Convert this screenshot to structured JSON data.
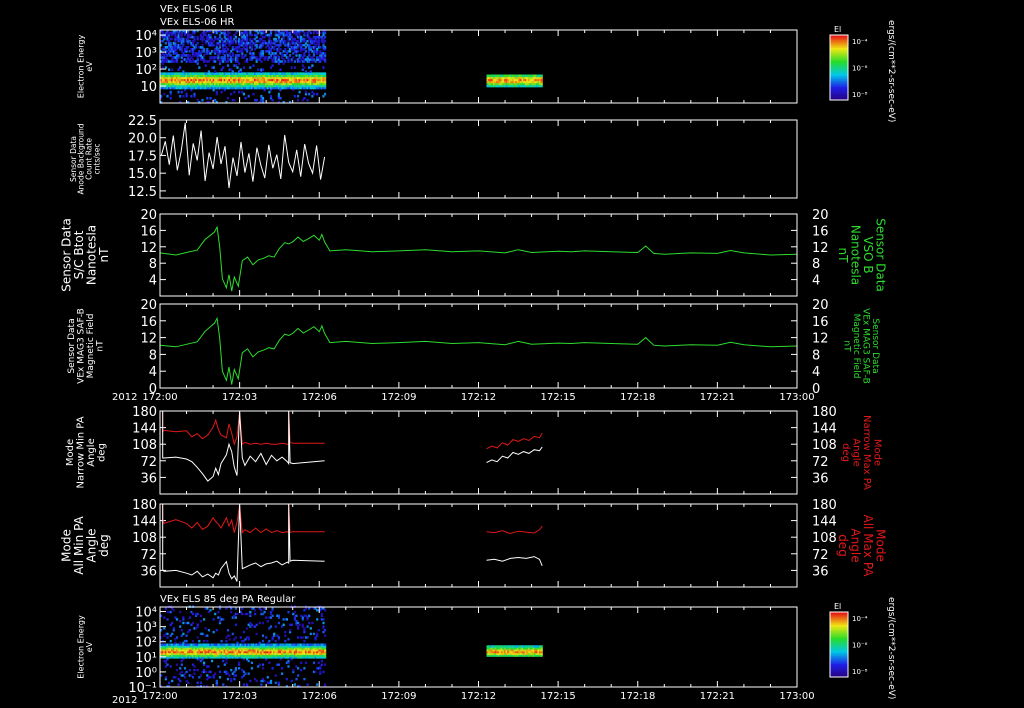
{
  "figure": {
    "top_titles": [
      "VEx ELS-06 LR",
      "VEx ELS-06 HR"
    ],
    "bottom_panel_title": "VEx ELS 85 deg PA Regular",
    "year_label": "2012",
    "colors": {
      "background": "#000000",
      "axis": "#ffffff",
      "series_white": "#ffffff",
      "series_green": "#2ddc2d",
      "series_red": "#e01818"
    }
  },
  "chart_data": [
    {
      "id": "spec-top",
      "type": "heatmap",
      "ylabel": [
        "Electron Energy",
        "eV"
      ],
      "yscale": "log",
      "ylim": [
        1,
        20000
      ],
      "yticks": [
        {
          "v": 10,
          "label": "10"
        },
        {
          "v": 100,
          "label": "10²"
        },
        {
          "v": 1000,
          "label": "10³"
        },
        {
          "v": 10000,
          "label": "10⁴"
        }
      ],
      "x_data_intervals_min": [
        [
          0,
          6.2
        ],
        [
          12.3,
          14.4
        ]
      ],
      "colorbar": {
        "title": "El",
        "unit": "ergs/(cm**2-sr-sec-eV)",
        "ticks": [
          "10⁻⁴",
          "10⁻⁶",
          "10⁻⁸"
        ]
      }
    },
    {
      "id": "anode-bg",
      "type": "line",
      "ylabel": [
        "Sensor Data",
        "Anode Background",
        "Count Rate",
        "cnts/sec"
      ],
      "ylim": [
        11.5,
        22.5
      ],
      "yticks": [
        12.5,
        15.0,
        17.5,
        20.0,
        22.5
      ],
      "ytick_labels": [
        "12.5",
        "15.0",
        "17.5",
        "20.0",
        "22.5"
      ],
      "series": [
        {
          "color": "white",
          "x": [
            0.05,
            0.2,
            0.35,
            0.5,
            0.65,
            0.8,
            0.95,
            1.1,
            1.25,
            1.4,
            1.55,
            1.7,
            1.85,
            2.0,
            2.15,
            2.3,
            2.45,
            2.6,
            2.75,
            2.9,
            3.05,
            3.2,
            3.35,
            3.5,
            3.65,
            3.8,
            3.95,
            4.1,
            4.25,
            4.4,
            4.55,
            4.7,
            4.85,
            5.0,
            5.15,
            5.3,
            5.45,
            5.6,
            5.75,
            5.9,
            6.05,
            6.2
          ],
          "y": [
            17.5,
            19.5,
            16.2,
            20.3,
            15.4,
            18.1,
            22.1,
            14.7,
            19.2,
            16.8,
            21.0,
            13.9,
            17.9,
            15.6,
            20.1,
            16.3,
            18.8,
            12.9,
            17.2,
            14.6,
            19.4,
            15.1,
            17.8,
            13.8,
            18.6,
            16.1,
            14.3,
            19.0,
            15.7,
            17.6,
            14.2,
            20.4,
            16.5,
            15.2,
            18.3,
            14.5,
            19.1,
            16.4,
            15.0,
            18.9,
            14.1,
            17.3
          ]
        }
      ]
    },
    {
      "id": "vso-b",
      "type": "line",
      "ylabel_left": [
        "Sensor Data",
        "S/C Btot",
        "Nanotesla",
        "nT"
      ],
      "ylabel_right": [
        "Sensor Data",
        "VSO B",
        "Nanotesla",
        "nT"
      ],
      "ylim": [
        0,
        20
      ],
      "yticks": [
        4,
        8,
        12,
        16,
        20
      ],
      "ytick_labels": [
        "4",
        "8",
        "12",
        "16",
        "20"
      ],
      "series": [
        {
          "color": "green",
          "x": [
            0,
            0.6,
            1.0,
            1.4,
            1.7,
            1.9,
            2.05,
            2.15,
            2.25,
            2.35,
            2.5,
            2.6,
            2.7,
            2.8,
            2.95,
            3.1,
            3.3,
            3.5,
            3.7,
            3.9,
            4.1,
            4.3,
            4.5,
            4.7,
            4.85,
            5.0,
            5.2,
            5.4,
            5.6,
            5.8,
            6.0,
            6.1,
            6.2,
            6.4,
            7,
            8,
            9,
            10,
            11,
            12,
            13,
            13.5,
            14,
            15,
            15.5,
            16,
            17,
            18,
            18.3,
            18.6,
            19,
            20,
            21,
            21.5,
            22,
            23,
            24
          ],
          "y": [
            10.5,
            10.0,
            10.6,
            11.2,
            13.8,
            14.8,
            15.6,
            16.8,
            12.0,
            4.2,
            2.0,
            5.2,
            1.2,
            4.6,
            2.4,
            8.6,
            9.5,
            7.6,
            8.8,
            9.2,
            9.8,
            9.5,
            11.6,
            13.0,
            12.7,
            13.2,
            14.4,
            13.3,
            14.0,
            14.8,
            13.6,
            15.0,
            13.2,
            11.0,
            11.3,
            10.8,
            11.0,
            11.3,
            10.8,
            11.0,
            10.5,
            11.3,
            10.6,
            10.9,
            10.8,
            11.0,
            10.8,
            10.6,
            12.2,
            10.4,
            10.2,
            10.5,
            10.4,
            11.1,
            10.5,
            10.0,
            10.2
          ]
        }
      ]
    },
    {
      "id": "mag3-saf",
      "type": "line",
      "ylabel_left": [
        "Sensor Data",
        "VEx MAG3 SAF-B",
        "Magnetic Field",
        "nT"
      ],
      "ylabel_right": [
        "Sensor Data",
        "VEx MAG3 SAF-B",
        "Magnetic Field",
        "nT"
      ],
      "ylim": [
        0,
        20
      ],
      "yticks": [
        0,
        4,
        8,
        12,
        16,
        20
      ],
      "ytick_labels": [
        "0",
        "4",
        "8",
        "12",
        "16",
        "20"
      ],
      "series": [
        {
          "color": "green",
          "x": [
            0,
            0.6,
            1.0,
            1.4,
            1.7,
            1.9,
            2.05,
            2.15,
            2.25,
            2.35,
            2.5,
            2.6,
            2.7,
            2.8,
            2.95,
            3.1,
            3.3,
            3.5,
            3.7,
            3.9,
            4.1,
            4.3,
            4.5,
            4.7,
            4.85,
            5.0,
            5.2,
            5.4,
            5.6,
            5.8,
            6.0,
            6.1,
            6.2,
            6.4,
            7,
            8,
            9,
            10,
            11,
            12,
            13,
            13.5,
            14,
            15,
            15.5,
            16,
            17,
            18,
            18.3,
            18.6,
            19,
            20,
            21,
            21.5,
            22,
            23,
            24
          ],
          "y": [
            10.2,
            9.8,
            10.4,
            11.0,
            13.5,
            14.6,
            15.4,
            16.6,
            11.8,
            4.0,
            1.8,
            5.0,
            0.8,
            4.4,
            2.2,
            8.4,
            9.3,
            7.4,
            8.6,
            9.0,
            9.6,
            9.3,
            11.4,
            12.8,
            12.5,
            13.0,
            14.2,
            13.1,
            13.8,
            14.6,
            13.4,
            14.8,
            13.0,
            10.8,
            11.1,
            10.6,
            10.8,
            11.1,
            10.6,
            10.8,
            10.3,
            11.1,
            10.4,
            10.7,
            10.6,
            10.8,
            10.6,
            10.4,
            12.0,
            10.2,
            10.0,
            10.3,
            10.2,
            10.9,
            10.3,
            9.8,
            10.0
          ]
        }
      ]
    },
    {
      "id": "narrow-pa",
      "type": "line",
      "ylabel_left": [
        "Mode",
        "Narrow Min PA",
        "Angle",
        "deg"
      ],
      "ylabel_right": [
        "Mode",
        "Narrow Max PA",
        "Angle",
        "deg"
      ],
      "ylim": [
        0,
        180
      ],
      "yticks": [
        36,
        72,
        108,
        144,
        180
      ],
      "ytick_labels": [
        "36",
        "72",
        "108",
        "144",
        "180"
      ],
      "series": [
        {
          "color": "red",
          "segments": [
            {
              "x": [
                0.1,
                0.1,
                0.15,
                0.6,
                1.0,
                1.2,
                1.4,
                1.6,
                1.8,
                2.0,
                2.1,
                2.2,
                2.3,
                2.5,
                2.6,
                2.7,
                2.8,
                2.9,
                3.0,
                3.1,
                3.2,
                3.4,
                3.6,
                3.8,
                4.0,
                4.2,
                4.4,
                4.6,
                4.8,
                4.85,
                4.85,
                4.9,
                5.0,
                6.2
              ],
              "y": [
                180,
                135,
                138,
                135,
                137,
                124,
                131,
                120,
                128,
                145,
                160,
                140,
                128,
                122,
                152,
                132,
                108,
                124,
                178,
                108,
                112,
                108,
                110,
                108,
                110,
                108,
                108,
                110,
                108,
                108,
                180,
                112,
                110,
                110
              ]
            },
            {
              "x": [
                12.3,
                12.5,
                12.7,
                12.9,
                13.1,
                13.3,
                13.5,
                13.7,
                13.9,
                14.1,
                14.3,
                14.4
              ],
              "y": [
                98,
                104,
                100,
                111,
                106,
                118,
                114,
                120,
                116,
                125,
                122,
                132
              ]
            }
          ]
        },
        {
          "color": "white",
          "segments": [
            {
              "x": [
                0.1,
                0.1,
                0.15,
                0.6,
                1.0,
                1.2,
                1.4,
                1.6,
                1.8,
                2.0,
                2.1,
                2.2,
                2.3,
                2.5,
                2.6,
                2.7,
                2.8,
                2.9,
                3.0,
                3.1,
                3.2,
                3.4,
                3.6,
                3.8,
                4.0,
                4.2,
                4.4,
                4.6,
                4.8,
                4.85,
                4.85,
                4.9,
                5.0,
                6.2
              ],
              "y": [
                180,
                78,
                78,
                80,
                76,
                70,
                58,
                44,
                28,
                38,
                56,
                42,
                66,
                85,
                108,
                92,
                58,
                40,
                178,
                78,
                62,
                82,
                70,
                88,
                64,
                84,
                72,
                80,
                70,
                66,
                180,
                68,
                66,
                72
              ]
            },
            {
              "x": [
                12.3,
                12.5,
                12.7,
                12.9,
                13.1,
                13.3,
                13.5,
                13.7,
                13.9,
                14.1,
                14.3,
                14.4
              ],
              "y": [
                68,
                74,
                70,
                82,
                78,
                90,
                86,
                92,
                88,
                96,
                94,
                102
              ]
            }
          ]
        }
      ]
    },
    {
      "id": "all-pa",
      "type": "line",
      "ylabel_left": [
        "Mode",
        "All Min PA",
        "Angle",
        "deg"
      ],
      "ylabel_right": [
        "Mode",
        "All Max PA",
        "Angle",
        "deg"
      ],
      "ylim": [
        0,
        180
      ],
      "yticks": [
        36,
        72,
        108,
        144,
        180
      ],
      "ytick_labels": [
        "36",
        "72",
        "108",
        "144",
        "180"
      ],
      "series": [
        {
          "color": "red",
          "segments": [
            {
              "x": [
                0.1,
                0.1,
                0.15,
                0.6,
                1.0,
                1.2,
                1.4,
                1.6,
                1.8,
                2.0,
                2.1,
                2.2,
                2.3,
                2.5,
                2.6,
                2.7,
                2.8,
                2.9,
                3.0,
                3.1,
                3.2,
                3.4,
                3.6,
                3.8,
                4.0,
                4.2,
                4.4,
                4.6,
                4.8,
                4.85,
                4.85,
                4.9,
                5.0,
                6.2
              ],
              "y": [
                180,
                148,
                138,
                146,
                138,
                128,
                140,
                125,
                132,
                150,
                142,
                136,
                128,
                150,
                132,
                145,
                118,
                140,
                178,
                118,
                124,
                118,
                128,
                118,
                126,
                118,
                122,
                118,
                120,
                118,
                180,
                118,
                120,
                120
              ]
            },
            {
              "x": [
                12.3,
                12.6,
                12.9,
                13.2,
                13.5,
                13.8,
                14.1,
                14.3,
                14.4
              ],
              "y": [
                120,
                118,
                122,
                116,
                121,
                119,
                117,
                124,
                132
              ]
            }
          ]
        },
        {
          "color": "white",
          "segments": [
            {
              "x": [
                0.1,
                0.1,
                0.15,
                0.6,
                1.0,
                1.2,
                1.4,
                1.6,
                1.8,
                2.0,
                2.1,
                2.2,
                2.3,
                2.5,
                2.6,
                2.7,
                2.8,
                2.9,
                3.0,
                3.1,
                3.2,
                3.4,
                3.6,
                3.8,
                4.0,
                4.2,
                4.4,
                4.6,
                4.8,
                4.85,
                4.85,
                4.9,
                5.0,
                6.2
              ],
              "y": [
                180,
                38,
                34,
                36,
                30,
                26,
                34,
                22,
                28,
                20,
                30,
                26,
                40,
                55,
                30,
                18,
                24,
                12,
                178,
                40,
                42,
                48,
                52,
                44,
                50,
                52,
                56,
                48,
                54,
                52,
                180,
                56,
                58,
                56
              ]
            },
            {
              "x": [
                12.3,
                12.6,
                12.9,
                13.2,
                13.5,
                13.8,
                14.1,
                14.3,
                14.4
              ],
              "y": [
                58,
                60,
                56,
                62,
                64,
                62,
                66,
                60,
                46
              ]
            }
          ]
        }
      ]
    },
    {
      "id": "spec-bottom",
      "type": "heatmap",
      "ylabel": [
        "Electron Energy",
        "eV"
      ],
      "yscale": "log",
      "ylim": [
        0.1,
        20000
      ],
      "yticks": [
        {
          "v": 0.1,
          "label": "10⁻¹"
        },
        {
          "v": 1,
          "label": "10⁰"
        },
        {
          "v": 10,
          "label": "10¹"
        },
        {
          "v": 100,
          "label": "10²"
        },
        {
          "v": 1000,
          "label": "10³"
        },
        {
          "v": 10000,
          "label": "10⁴"
        }
      ],
      "x_data_intervals_min": [
        [
          0,
          6.2
        ],
        [
          12.3,
          14.4
        ]
      ],
      "colorbar": {
        "title": "El",
        "unit": "ergs/(cm**2-sr-sec-eV)",
        "ticks": [
          "10⁻⁴",
          "10⁻⁶",
          "10⁻⁸"
        ]
      }
    }
  ],
  "time_axis": {
    "unit": "minutes after 172:00",
    "range": [
      0,
      24
    ],
    "ticks": [
      {
        "v": 0,
        "label": "172:00"
      },
      {
        "v": 3,
        "label": "172:03"
      },
      {
        "v": 6,
        "label": "172:06"
      },
      {
        "v": 9,
        "label": "172:09"
      },
      {
        "v": 12,
        "label": "172:12"
      },
      {
        "v": 15,
        "label": "172:15"
      },
      {
        "v": 18,
        "label": "172:18"
      },
      {
        "v": 21,
        "label": "172:21"
      },
      {
        "v": 24,
        "label": "173:00"
      }
    ]
  }
}
